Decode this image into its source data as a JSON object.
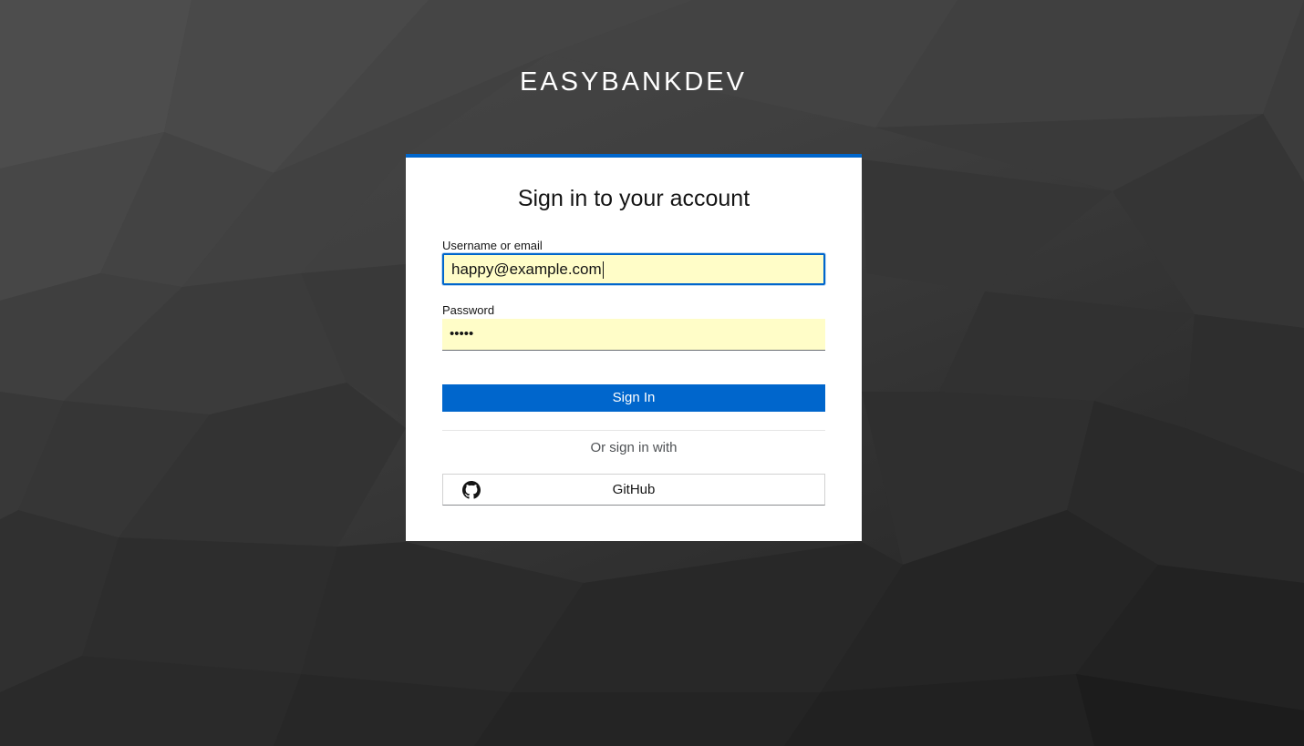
{
  "brand": {
    "name": "EASYBANKDEV"
  },
  "login": {
    "title": "Sign in to your account",
    "username_label": "Username or email",
    "username_value": "happy@example.com",
    "password_label": "Password",
    "password_masked": "•••••",
    "sign_in_label": "Sign In",
    "or_text": "Or sign in with",
    "github_label": "GitHub",
    "github_icon": "github-icon"
  },
  "colors": {
    "accent": "#0066cc",
    "autofill_bg": "#fffdc8",
    "background_dark": "#2a2a2a"
  }
}
